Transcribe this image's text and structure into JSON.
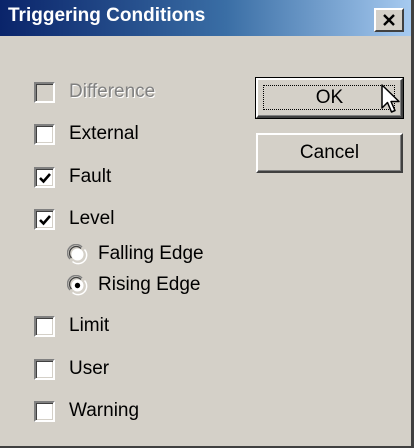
{
  "window": {
    "title": "Triggering Conditions",
    "close_label": "×"
  },
  "conditions": [
    {
      "label": "Difference",
      "checked": false,
      "enabled": false
    },
    {
      "label": "External",
      "checked": false,
      "enabled": true
    },
    {
      "label": "Fault",
      "checked": true,
      "enabled": true
    },
    {
      "label": "Level",
      "checked": true,
      "enabled": true
    },
    {
      "label": "Limit",
      "checked": false,
      "enabled": true
    },
    {
      "label": "User",
      "checked": false,
      "enabled": true
    },
    {
      "label": "Warning",
      "checked": false,
      "enabled": true
    }
  ],
  "level_edge": {
    "options": [
      {
        "label": "Falling Edge",
        "selected": false
      },
      {
        "label": "Rising Edge",
        "selected": true
      }
    ]
  },
  "buttons": {
    "ok_label": "OK",
    "cancel_label": "Cancel"
  },
  "colors": {
    "dialog_face": "#d4d0c8",
    "title_start": "#0a246a",
    "title_end": "#a6caf0",
    "disabled_text": "#808080"
  },
  "icons": {
    "close": "close-icon",
    "check": "checkmark-icon",
    "radio": "radio-dot-icon",
    "cursor": "mouse-pointer-icon"
  }
}
